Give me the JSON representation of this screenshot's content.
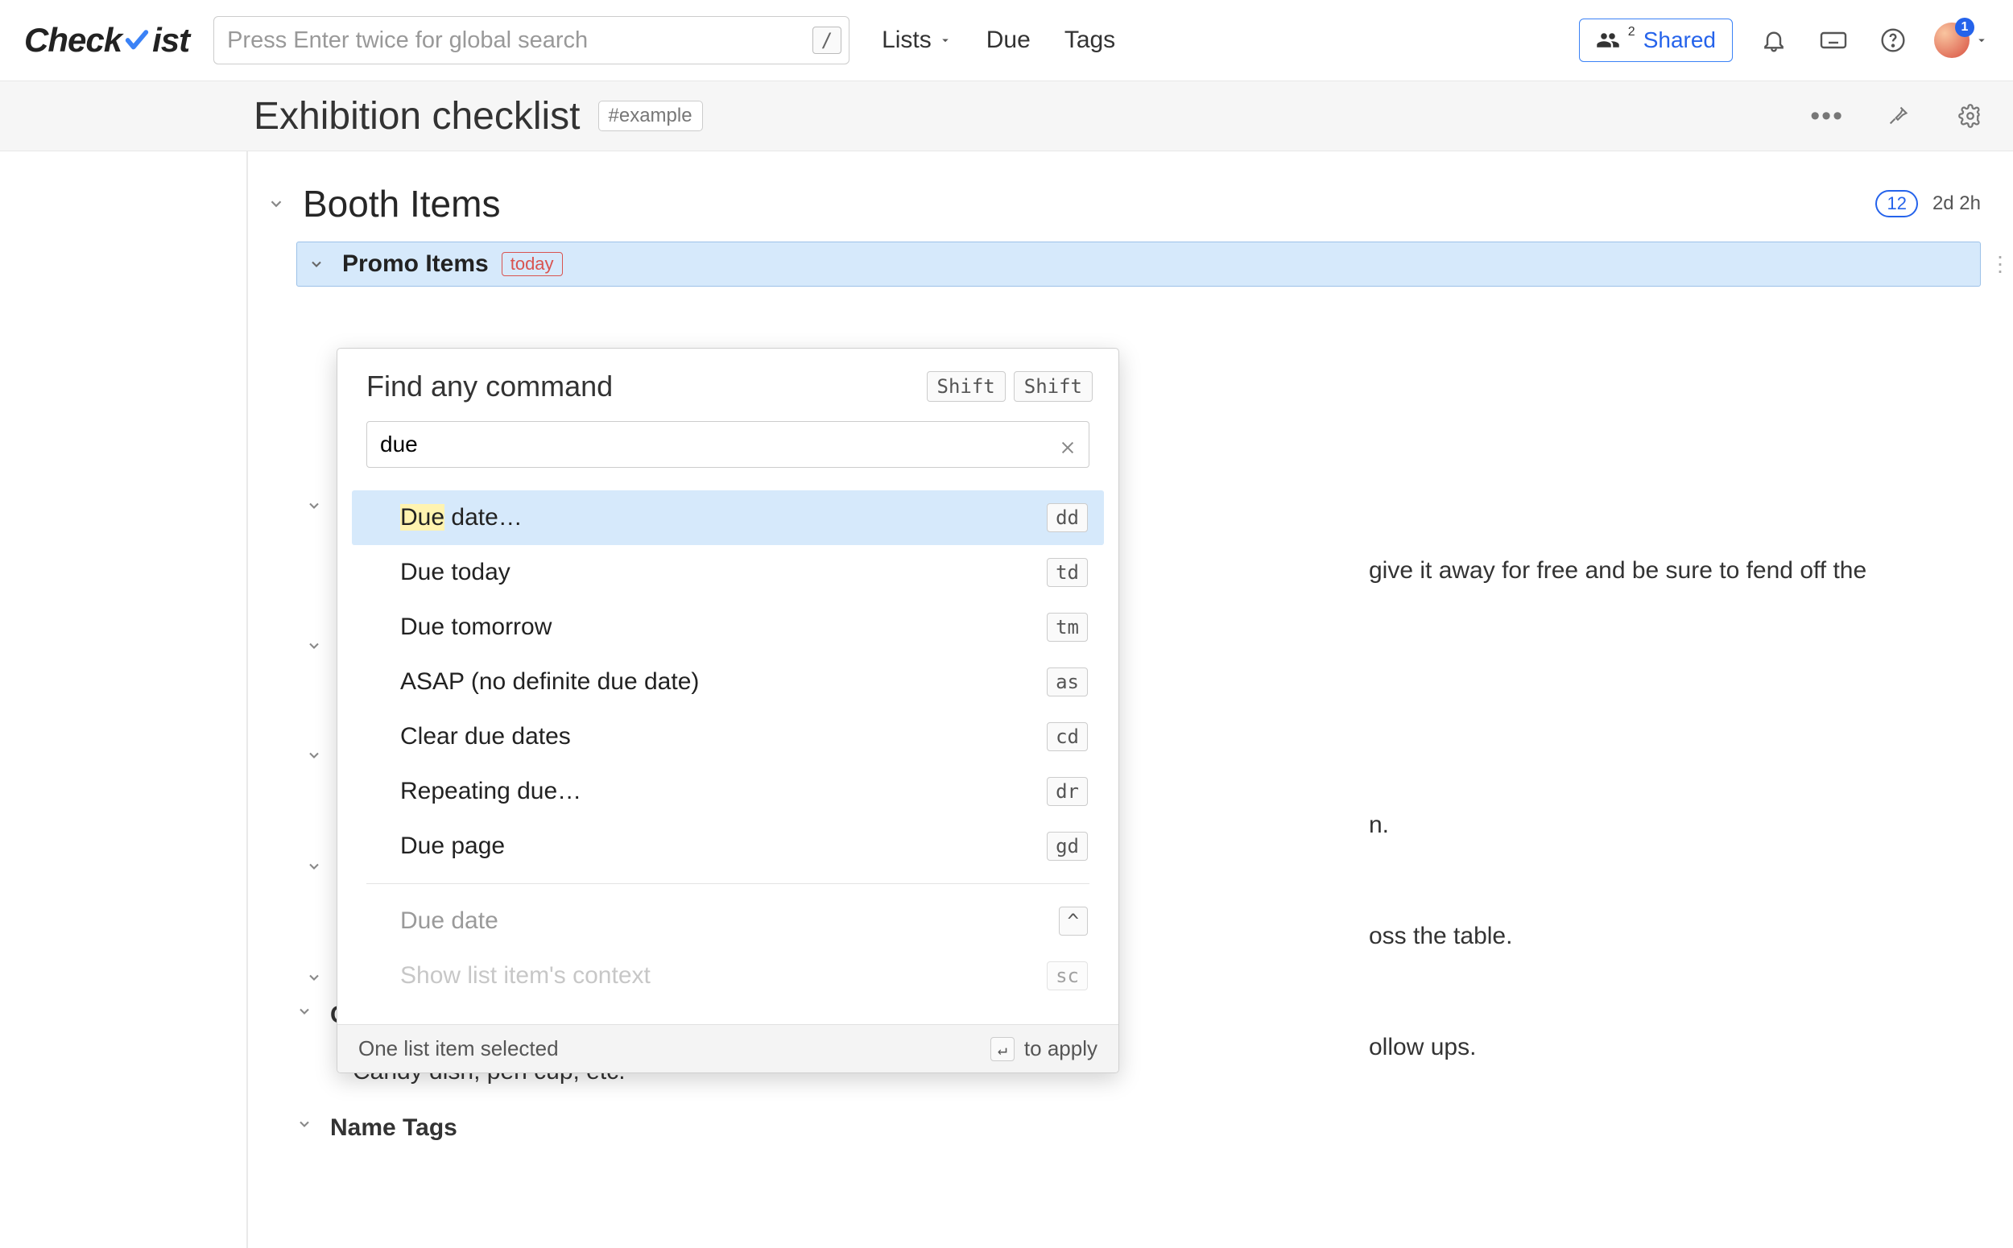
{
  "brand": {
    "prefix": "Check",
    "suffix": "ist"
  },
  "search": {
    "placeholder": "Press Enter twice for global search",
    "shortcut": "/"
  },
  "nav": {
    "lists": "Lists",
    "due": "Due",
    "tags": "Tags"
  },
  "header_right": {
    "shared_label": "Shared",
    "shared_count": "2",
    "avatar_badge": "1"
  },
  "list": {
    "title": "Exhibition checklist",
    "tag": "#example"
  },
  "booth": {
    "title": "Booth Items",
    "count": "12",
    "duration": "2d 2h"
  },
  "selected": {
    "label": "Promo Items",
    "due_tag": "today"
  },
  "peek_lines": {
    "l1": "give it away for free and be sure to fend off the",
    "l2": "n.",
    "l3": "oss the table.",
    "l4": "ollow ups."
  },
  "outline": {
    "containers": "Containers to hold your giveaways",
    "containers_sub": "Candy dish, pen cup, etc.",
    "name_tags": "Name Tags"
  },
  "palette": {
    "title": "Find any command",
    "key1": "Shift",
    "key2": "Shift",
    "query": "due",
    "items": [
      {
        "highlight": "Due",
        "rest": " date…",
        "sc": "dd",
        "active": true
      },
      {
        "highlight": "",
        "rest": "Due today",
        "sc": "td"
      },
      {
        "highlight": "",
        "rest": "Due tomorrow",
        "sc": "tm"
      },
      {
        "highlight": "",
        "rest": "ASAP (no definite due date)",
        "sc": "as"
      },
      {
        "highlight": "",
        "rest": "Clear due dates",
        "sc": "cd"
      },
      {
        "highlight": "",
        "rest": "Repeating due…",
        "sc": "dr"
      },
      {
        "highlight": "",
        "rest": "Due page",
        "sc": "gd"
      }
    ],
    "extra": [
      {
        "label": "Due date",
        "sc": "^"
      },
      {
        "label": "Show list item's context",
        "sc": "sc"
      }
    ],
    "footer_left": "One list item selected",
    "footer_right": "to apply",
    "enter_glyph": "↵"
  }
}
